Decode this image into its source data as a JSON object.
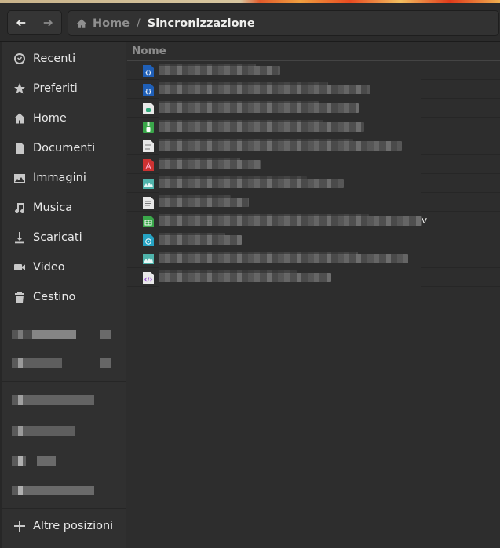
{
  "window": {
    "accent_strip_colors": [
      "#c9b38a",
      "#e25a2a",
      "#f0a040",
      "#e03a1a"
    ]
  },
  "toolbar": {
    "back_button": {
      "icon": "arrow-left-icon",
      "enabled": true
    },
    "forward_button": {
      "icon": "arrow-right-icon",
      "enabled": false
    },
    "breadcrumb": [
      {
        "label": "Home",
        "icon": "home-icon",
        "current": false
      },
      {
        "label": "Sincronizzazione",
        "current": true
      }
    ],
    "separator": "/"
  },
  "sidebar": {
    "places": [
      {
        "label": "Recenti",
        "icon": "clock-icon"
      },
      {
        "label": "Preferiti",
        "icon": "star-icon"
      },
      {
        "label": "Home",
        "icon": "home-icon"
      },
      {
        "label": "Documenti",
        "icon": "document-icon"
      },
      {
        "label": "Immagini",
        "icon": "image-icon"
      },
      {
        "label": "Musica",
        "icon": "music-icon"
      },
      {
        "label": "Scaricati",
        "icon": "download-icon"
      },
      {
        "label": "Video",
        "icon": "video-icon"
      },
      {
        "label": "Cestino",
        "icon": "trash-icon"
      }
    ],
    "devices_redacted_count": 2,
    "bookmarks_redacted_count": 4,
    "other_locations": {
      "label": "Altre posizioni",
      "icon": "plus-icon"
    }
  },
  "file_list": {
    "column_header": "Nome",
    "rows": [
      {
        "type": "json",
        "icon": "json-file-icon",
        "name_redacted": true
      },
      {
        "type": "json",
        "icon": "json-file-icon",
        "name_redacted": true
      },
      {
        "type": "database",
        "icon": "database-file-icon",
        "name_redacted": true
      },
      {
        "type": "archive",
        "icon": "archive-file-icon",
        "name_redacted": true
      },
      {
        "type": "text",
        "icon": "text-file-icon",
        "name_redacted": true
      },
      {
        "type": "pdf",
        "icon": "pdf-file-icon",
        "name_redacted": true
      },
      {
        "type": "image",
        "icon": "image-file-icon",
        "name_redacted": true
      },
      {
        "type": "text",
        "icon": "text-file-icon",
        "name_redacted": true
      },
      {
        "type": "spreadsheet",
        "icon": "spreadsheet-file-icon",
        "name_redacted": true,
        "visible_tail": "v"
      },
      {
        "type": "disk-image",
        "icon": "disc-file-icon",
        "name_redacted": true
      },
      {
        "type": "image",
        "icon": "image-file-icon",
        "name_redacted": true
      },
      {
        "type": "html",
        "icon": "code-file-icon",
        "name_redacted": true
      }
    ]
  },
  "colors": {
    "background": "#2d2d2d",
    "sidebar": "#303030",
    "header_text": "#8c8c8c",
    "json_icon": "#1f5fb7",
    "archive_icon": "#3aa74a",
    "pdf_icon": "#cc3232",
    "image_icon": "#4fb3ab",
    "spreadsheet_icon": "#3aa74a",
    "disc_icon": "#26a3c3",
    "code_icon": "#9a4fd6"
  }
}
